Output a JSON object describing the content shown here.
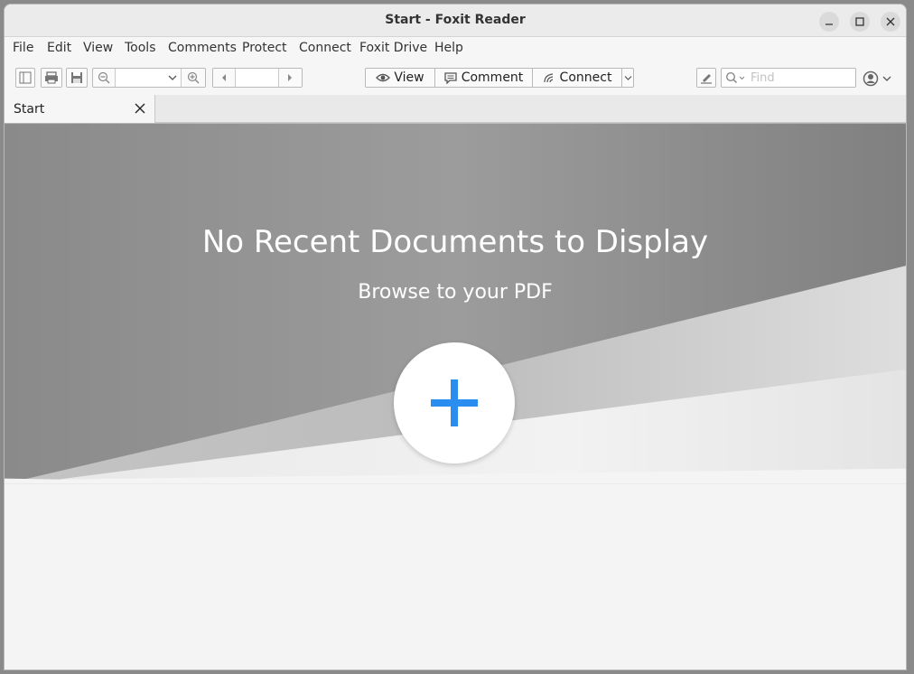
{
  "window": {
    "title": "Start - Foxit Reader",
    "controls": [
      "minimize-icon",
      "maximize-icon",
      "close-icon"
    ]
  },
  "menu": {
    "items": [
      "File",
      "Edit",
      "View",
      "Tools",
      "Comments",
      "Protect",
      "Connect",
      "Foxit Drive",
      "Help"
    ]
  },
  "toolbar": {
    "view_label": "View",
    "comment_label": "Comment",
    "connect_label": "Connect",
    "find_placeholder": "Find",
    "zoom_value": "",
    "page_value": ""
  },
  "tabs": [
    {
      "label": "Start"
    }
  ],
  "start_page": {
    "heading": "No Recent Documents to Display",
    "subheading": "Browse to your PDF",
    "add_symbol_color": "#2a8df0"
  },
  "colors": {
    "accent_blue": "#2a8df0",
    "hero_gray": "#8c8c8c"
  }
}
